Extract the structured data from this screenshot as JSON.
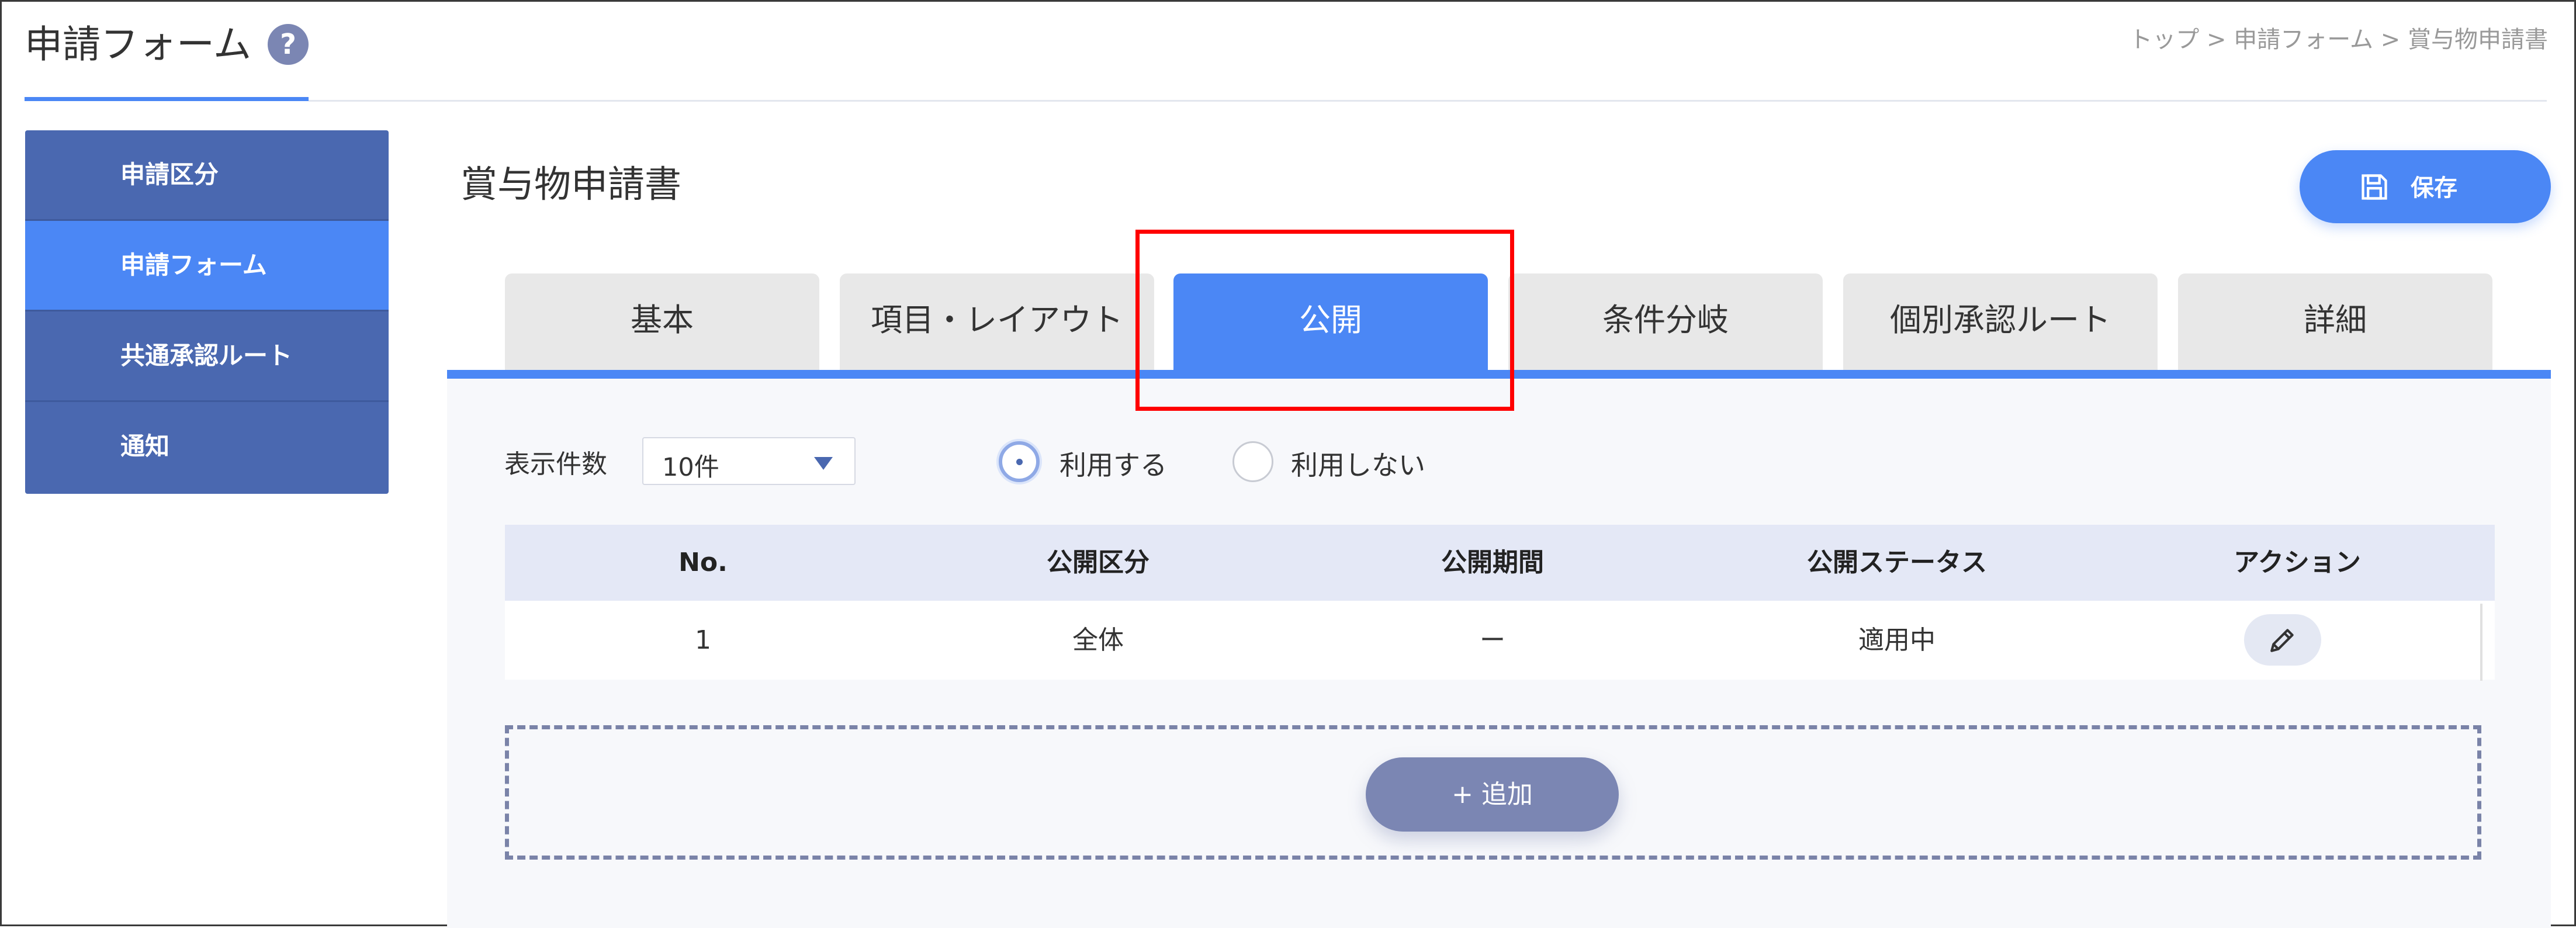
{
  "header": {
    "title": "申請フォーム",
    "help_symbol": "?",
    "breadcrumb": [
      "トップ",
      ">",
      "申請フォーム",
      ">",
      "賞与物申請書"
    ]
  },
  "sidebar": {
    "items": [
      {
        "label": "申請区分",
        "active": false
      },
      {
        "label": "申請フォーム",
        "active": true
      },
      {
        "label": "共通承認ルート",
        "active": false
      },
      {
        "label": "通知",
        "active": false
      }
    ]
  },
  "main": {
    "title": "賞与物申請書",
    "save_label": "保存",
    "tabs": [
      {
        "label": "基本",
        "active": false
      },
      {
        "label": "項目・レイアウト",
        "active": false
      },
      {
        "label": "公開",
        "active": true
      },
      {
        "label": "条件分岐",
        "active": false
      },
      {
        "label": "個別承認ルート",
        "active": false
      },
      {
        "label": "詳細",
        "active": false
      }
    ],
    "display_count": {
      "label": "表示件数",
      "value": "10件"
    },
    "usage": {
      "on_label": "利用する",
      "off_label": "利用しない",
      "selected": "利用する"
    },
    "table": {
      "headers": [
        "No.",
        "公開区分",
        "公開期間",
        "公開ステータス",
        "アクション"
      ],
      "rows": [
        {
          "no": "1",
          "category": "全体",
          "period": "ー",
          "status": "適用中"
        }
      ]
    },
    "add_label": "+ 追加"
  },
  "colors": {
    "accent": "#4b87f5",
    "sidebar": "#4a68b0",
    "muted_button": "#7b86b3",
    "highlight": "#ff0000"
  },
  "icons": {
    "help": "help-icon",
    "save": "floppy-disk-icon",
    "edit": "pencil-icon",
    "dropdown": "caret-down-icon"
  }
}
